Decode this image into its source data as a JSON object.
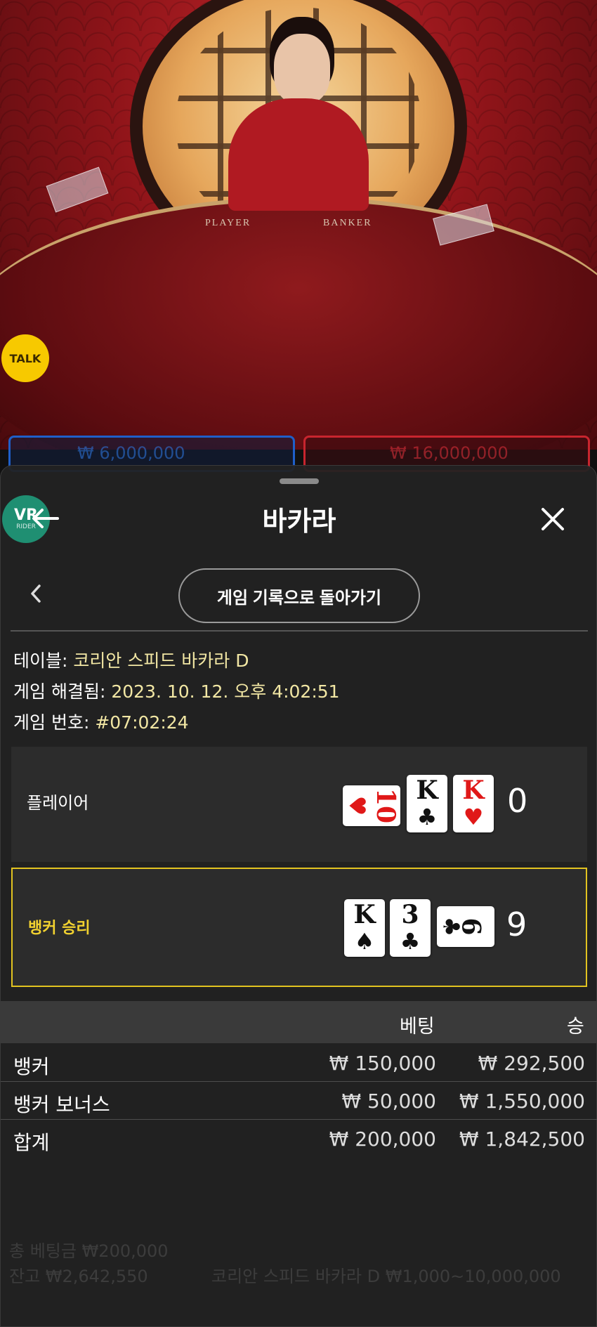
{
  "video": {
    "table_labels": {
      "player": "PLAYER",
      "banker": "BANKER"
    },
    "talk_label": "TALK",
    "bet_totals": {
      "player": "₩ 6,000,000",
      "banker": "₩ 16,000,000"
    }
  },
  "sheet": {
    "title": "바카라",
    "vr_badge": {
      "logo": "VR",
      "sub": "RIDER"
    },
    "history_button": "게임 기록으로 돌아가기",
    "info": [
      {
        "key": "테이블: ",
        "value": "코리안 스피드 바카라 D"
      },
      {
        "key": "게임 해결됨: ",
        "value": "2023. 10. 12. 오후 4:02:51"
      },
      {
        "key": "게임 번호: ",
        "value": "#07:02:24"
      }
    ],
    "player": {
      "label": "플레이어",
      "score": "0",
      "cards": [
        {
          "rank": "10",
          "suit": "♥",
          "color": "#e01818",
          "orientation": "side"
        },
        {
          "rank": "K",
          "suit": "♣",
          "color": "#111111",
          "orientation": "up"
        },
        {
          "rank": "K",
          "suit": "♥",
          "color": "#e01818",
          "orientation": "up"
        }
      ]
    },
    "banker": {
      "label": "뱅커 승리",
      "score": "9",
      "cards": [
        {
          "rank": "K",
          "suit": "♠",
          "color": "#111111",
          "orientation": "up"
        },
        {
          "rank": "3",
          "suit": "♣",
          "color": "#111111",
          "orientation": "up"
        },
        {
          "rank": "6",
          "suit": "♣",
          "color": "#111111",
          "orientation": "side"
        }
      ]
    },
    "bets": {
      "headers": {
        "bet": "베팅",
        "win": "승"
      },
      "rows": [
        {
          "name": "뱅커",
          "bet": "₩ 150,000",
          "win": "₩ 292,500"
        },
        {
          "name": "뱅커 보너스",
          "bet": "₩ 50,000",
          "win": "₩ 1,550,000"
        },
        {
          "name": "합계",
          "bet": "₩ 200,000",
          "win": "₩ 1,842,500"
        }
      ]
    }
  },
  "background_ui": {
    "total_bet": "총 베팅금 ₩200,000",
    "balance": "잔고 ₩2,642,550",
    "table_limits": "코리안 스피드 바카라 D ₩1,000~10,000,000"
  },
  "colors": {
    "accent_yellow": "#e2c320",
    "info_value": "#f2e7a4",
    "player_blue": "#1f5fc9",
    "banker_red": "#c8252e"
  }
}
